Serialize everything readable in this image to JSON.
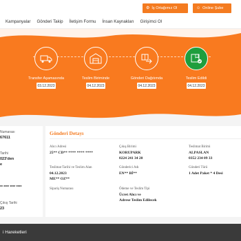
{
  "header": {
    "partner_label": "İş Ortağımız Ol",
    "branch_label": "Online Şube",
    "partner_icon": "handshake-icon",
    "branch_icon": "user-icon"
  },
  "nav": {
    "items": [
      "Kampanyalar",
      "Gönderi Takip",
      "İletişim Formu",
      "İnsan Kaynakları",
      "Girişimci Ol"
    ]
  },
  "progress": {
    "steps": [
      {
        "label": "Transfer Aşamasında",
        "date": "03.12.2023",
        "icon": "truck-icon",
        "active": false
      },
      {
        "label": "Teslim Biriminde",
        "date": "04.12.2023",
        "icon": "warehouse-icon",
        "active": false
      },
      {
        "label": "Gönderi Dağıtımda",
        "date": "04.12.2023",
        "icon": "package-delivery-icon",
        "active": false
      },
      {
        "label": "Teslim Edildi",
        "date": "04.12.2023",
        "icon": "delivered-box-icon",
        "active": true
      }
    ],
    "colors": {
      "accent": "#f97a1f",
      "success": "#1e9e3d"
    }
  },
  "left_card": {
    "items": [
      {
        "label": "Numarası",
        "value": "67611"
      },
      {
        "label": "Tarihi",
        "value": "023'den"
      },
      {
        "label": "",
        "value": "** **** **** ****"
      },
      {
        "label": "Çıkış Tarihi",
        "value": "23"
      }
    ],
    "extra_value": "e"
  },
  "detail": {
    "title": "Gönderi Detayı",
    "fields": [
      {
        "label": "Alıcı Adresi",
        "value": "25** CD** **** **** ****"
      },
      {
        "label": "Çıkış Birimi",
        "value": "KORUPARK\n0224 241 34 20"
      },
      {
        "label": "Teslimat Birimi",
        "value": "ALPASLAN\n0352 234 09 33"
      },
      {
        "label": "Teslimat Tarihi ve Teslim Alan",
        "value": "04.12.2023\nME** OZ**"
      },
      {
        "label": "Gönderici Adı",
        "value": "EN** Bİ**"
      },
      {
        "label": "Gönderi Türü",
        "value": "1 Adet Paket * 4 Desi"
      },
      {
        "label": "Sipariş Numarası",
        "value": ""
      },
      {
        "label": "Ödeme ve Teslim Tipi",
        "value": "Ücret Alıcı ve\nAdrese Teslim Edilecek"
      }
    ]
  },
  "movements": {
    "title": "i Hareketleri"
  }
}
